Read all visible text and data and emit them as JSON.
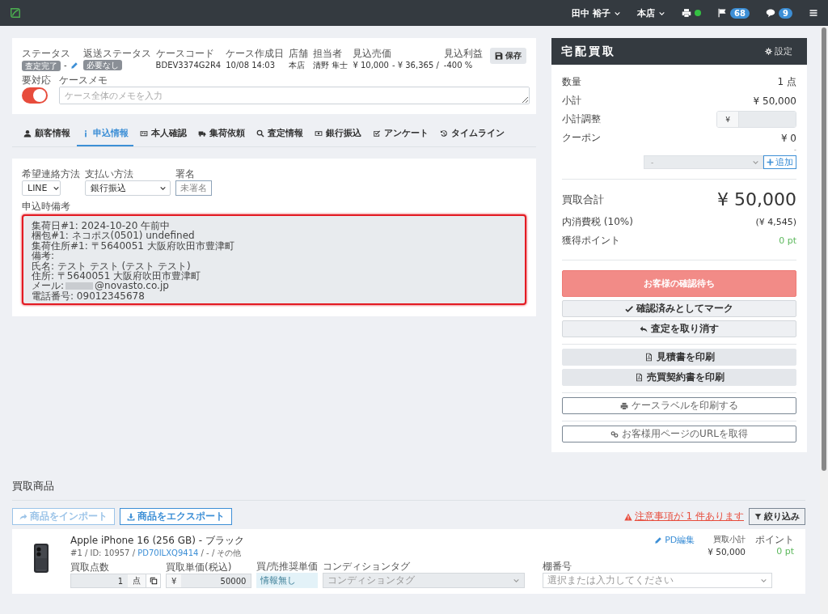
{
  "topbar": {
    "user": "田中 裕子",
    "store": "本店",
    "printer_online": true,
    "flag_count": "68",
    "message_count": "9"
  },
  "case": {
    "fields": [
      {
        "kind": "status",
        "label": "ステータス",
        "value": "査定完了",
        "note": "-"
      },
      {
        "kind": "badge",
        "label": "返送ステータス",
        "value": "必要なし"
      },
      {
        "kind": "text",
        "label": "ケースコード",
        "value": "BDEV3374G2R4"
      },
      {
        "kind": "text",
        "label": "ケース作成日",
        "value": "10/08 14:03"
      },
      {
        "kind": "text",
        "label": "店舗",
        "value": "本店"
      },
      {
        "kind": "text",
        "label": "担当者",
        "value": "清野 隼士"
      },
      {
        "kind": "text",
        "label": "見込売価",
        "value": "¥ 10,000",
        "note": "- ¥ 36,365 /"
      },
      {
        "kind": "text",
        "label": "見込利益",
        "value": "-400 %"
      }
    ],
    "save": "保存",
    "attention_label": "要対応",
    "attention_on": true,
    "memo_label": "ケースメモ",
    "memo_placeholder": "ケース全体のメモを入力"
  },
  "tabs": [
    {
      "label": "顧客情報",
      "selected": false
    },
    {
      "label": "申込情報",
      "selected": true
    },
    {
      "label": "本人確認",
      "selected": false
    },
    {
      "label": "集荷依頼",
      "selected": false
    },
    {
      "label": "査定情報",
      "selected": false
    },
    {
      "label": "銀行振込",
      "selected": false
    },
    {
      "label": "アンケート",
      "selected": false
    },
    {
      "label": "タイムライン",
      "selected": false
    }
  ],
  "application": {
    "contact": {
      "label": "希望連絡方法",
      "value": "LINE"
    },
    "payment": {
      "label": "支払い方法",
      "value": "銀行振込"
    },
    "signature": {
      "label": "署名",
      "value": "未署名"
    },
    "remarks": {
      "label": "申込時備考",
      "highlighted": true,
      "lines": [
        {
          "text": "集荷日#1: 2024-10-20 午前中"
        },
        {
          "text": "梱包#1: ネコポス(0501) undefined"
        },
        {
          "text": "集荷住所#1: 〒5640051 大阪府吹田市豊津町"
        },
        {
          "text": "備考:"
        },
        {
          "text": "氏名: テスト テスト (テスト テスト)"
        },
        {
          "text": "住所: 〒5640051 大阪府吹田市豊津町"
        },
        {
          "text": "メール:",
          "redacted_tail": "@novasto.co.jp"
        },
        {
          "text": "電話番号: 09012345678"
        }
      ]
    }
  },
  "summary": {
    "title": "宅配買取",
    "settings": "設定",
    "rows": [
      {
        "kind": "value",
        "label": "数量",
        "value": "1 点"
      },
      {
        "kind": "value",
        "label": "小計",
        "value": "¥ 50,000"
      },
      {
        "kind": "input",
        "label": "小計調整",
        "prefix": "¥"
      },
      {
        "kind": "value",
        "label": "クーポン",
        "value": "¥ 0"
      }
    ],
    "coupon_note": "-",
    "coupon_select": "-",
    "coupon_add": "追加",
    "total_label": "買取合計",
    "total": "¥ 50,000",
    "tax_label": "内消費税 (10%)",
    "tax": "(¥ 4,545)",
    "points_label": "獲得ポイント",
    "points": "0 pt",
    "status_button": "お客様の確認待ち",
    "groups": [
      [
        {
          "kind": "check",
          "label": "確認済みとしてマーク"
        },
        {
          "kind": "undo",
          "label": "査定を取り消す"
        }
      ],
      [
        {
          "kind": "pdf",
          "label": "見積書を印刷"
        },
        {
          "kind": "pdf",
          "label": "売買契約書を印刷"
        }
      ],
      [
        {
          "kind": "print",
          "label": "ケースラベルを印刷する"
        }
      ],
      [
        {
          "kind": "link",
          "label": "お客様用ページのURLを取得"
        }
      ]
    ]
  },
  "items": {
    "title": "買取商品",
    "import": "商品をインポート",
    "export": "商品をエクスポート",
    "warning": "注意事項が 1 件あります",
    "filter": "絞り込み",
    "products": [
      {
        "name": "Apple iPhone 16 (256 GB) - ブラック",
        "meta_before": "#1 / ID: 10957 /",
        "code": "PD70ILXQ9414",
        "meta_after": "/ - / その他",
        "edit": "PD編集",
        "subtotal_label": "買取小計",
        "subtotal": "¥ 50,000",
        "points_label": "ポイント",
        "points": "0 pt",
        "qty_label": "買取点数",
        "qty": "1",
        "qty_unit": "点",
        "price_label": "買取単価(税込)",
        "price_prefix": "¥",
        "price": "50000",
        "recommend_label": "買/売推奨単価",
        "recommend": "情報無し",
        "tag_label": "コンディションタグ",
        "tag_placeholder": "コンディションタグ",
        "shelf_label": "棚番号",
        "shelf_placeholder": "選択または入力してください"
      }
    ]
  }
}
